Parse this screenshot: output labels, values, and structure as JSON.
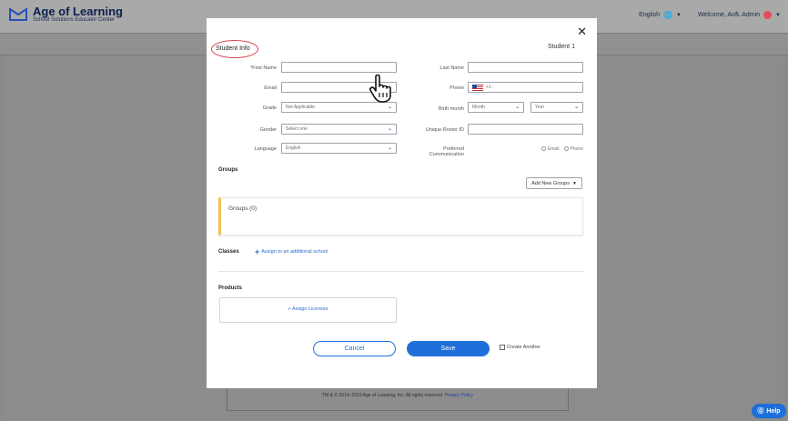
{
  "header": {
    "brand_title": "Age of Learning",
    "brand_subtitle": "School Solutions Educator Center",
    "language": "English",
    "welcome": "Welcome, AofL Admin"
  },
  "modal": {
    "section_title": "Student Info",
    "student_label": "Student 1",
    "fields": {
      "first_name_label": "*First Name",
      "last_name_label": "Last Name",
      "email_label": "Email",
      "phone_label": "Phone",
      "phone_code": "+1 -",
      "grade_label": "Grade",
      "grade_value": "Not Applicable",
      "birth_month_label": "Birth month",
      "month_value": "Month",
      "year_value": "Year",
      "gender_label": "Gender",
      "gender_value": "Select one",
      "roster_label": "Unique Roster ID",
      "language_label": "Language",
      "language_value": "English",
      "pref_comm_label": "Preferred Communication",
      "pref_email": "Email",
      "pref_phone": "Phone"
    },
    "groups_title": "Groups",
    "add_groups_label": "Add New Groups",
    "groups_count_label": "Groups (0)",
    "classes_title": "Classes",
    "assign_school_label": "Assign to an additional school",
    "products_title": "Products",
    "assign_licenses_label": "+ Assign Licenses",
    "cancel_label": "Cancel",
    "save_label": "Save",
    "create_another_label": "Create Another"
  },
  "footer": {
    "copyright": "TM & © 2014–2023 Age of Learning, Inc. All rights reserved.",
    "privacy_link": "Privacy Policy"
  },
  "help_label": "Help",
  "colors": {
    "accent_blue": "#1e6fd9",
    "highlight_red": "#d9424b",
    "group_bar_yellow": "#f2c14c"
  }
}
